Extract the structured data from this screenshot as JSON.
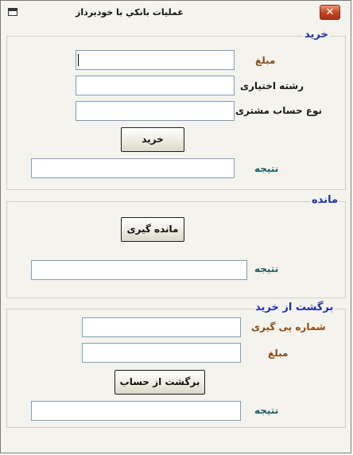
{
  "window": {
    "title": "عمليات بانكي با خوديرداز",
    "close_glyph": "✕",
    "app_icon": "window-icon"
  },
  "purchase": {
    "title": "خريد",
    "amount_label": "مبلغ",
    "amount_value": "",
    "ref_label": "رشته اختیاری",
    "ref_value": "",
    "account_type_label": "نوع حساب مشتری",
    "account_type_value": "",
    "button": "خريد",
    "result_label": "نتيجه",
    "result_value": ""
  },
  "balance": {
    "title": "مانده",
    "button": "مانده گيری",
    "result_label": "نتيجه",
    "result_value": ""
  },
  "refund": {
    "title": "برگشت از خريد",
    "tracking_label": "شماره پی گيری",
    "tracking_value": "",
    "amount_label": "مبلغ",
    "amount_value": "",
    "button": "برگشت از حساب",
    "result_label": "نتيجه",
    "result_value": ""
  }
}
